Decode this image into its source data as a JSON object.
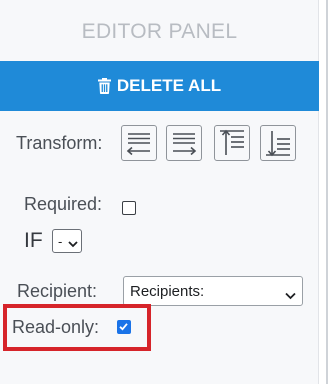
{
  "panel": {
    "title": "EDITOR PANEL",
    "delete_all_label": "DELETE ALL",
    "delete_icon": "trash-icon",
    "transform": {
      "label": "Transform:",
      "buttons": [
        {
          "name": "align-left-icon"
        },
        {
          "name": "align-right-icon"
        },
        {
          "name": "align-top-icon"
        },
        {
          "name": "align-bottom-icon"
        }
      ]
    },
    "required": {
      "label": "Required:",
      "checked": false
    },
    "if": {
      "label": "IF",
      "selected": "-"
    },
    "recipient": {
      "label": "Recipient:",
      "selected": "Recipients:"
    },
    "readonly": {
      "label": "Read-only:",
      "checked": true
    }
  },
  "colors": {
    "accent": "#1f8ad8",
    "highlight": "#d6242a",
    "checkbox_checked": "#1a73e8"
  }
}
